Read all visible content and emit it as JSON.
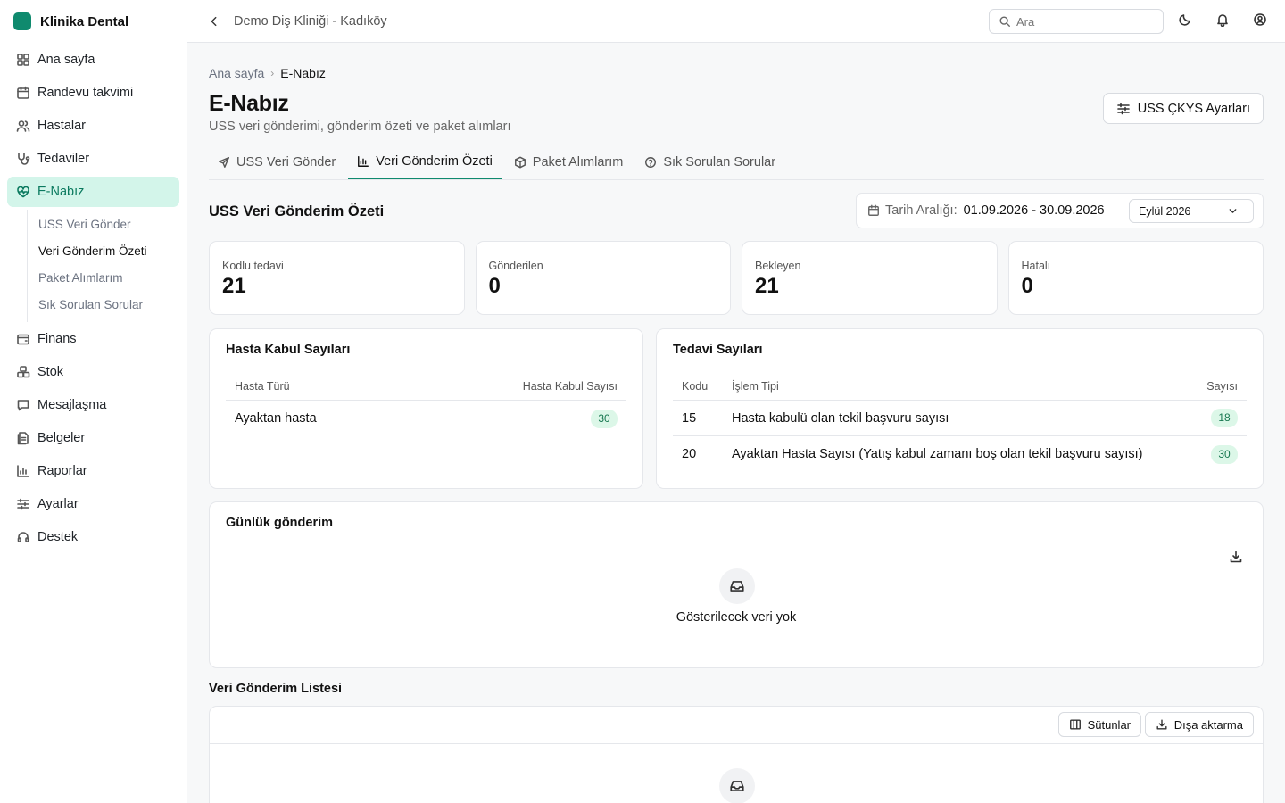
{
  "app": {
    "name": "Klinika Dental",
    "brand_color": "#0f8a6e"
  },
  "sidebar": {
    "items": [
      {
        "label": "Ana sayfa",
        "icon": "grid-icon"
      },
      {
        "label": "Randevu takvimi",
        "icon": "calendar-icon"
      },
      {
        "label": "Hastalar",
        "icon": "users-icon"
      },
      {
        "label": "Tedaviler",
        "icon": "stethoscope-icon"
      },
      {
        "label": "E-Nabız",
        "icon": "heart-pulse-icon",
        "active": true
      },
      {
        "label": "Finans",
        "icon": "wallet-icon"
      },
      {
        "label": "Stok",
        "icon": "boxes-icon"
      },
      {
        "label": "Mesajlaşma",
        "icon": "message-icon"
      },
      {
        "label": "Belgeler",
        "icon": "document-icon"
      },
      {
        "label": "Raporlar",
        "icon": "bar-chart-icon"
      },
      {
        "label": "Ayarlar",
        "icon": "sliders-icon"
      },
      {
        "label": "Destek",
        "icon": "headset-icon"
      }
    ],
    "subitems": [
      {
        "label": "USS Veri Gönder"
      },
      {
        "label": "Veri Gönderim Özeti",
        "active": true
      },
      {
        "label": "Paket Alımlarım"
      },
      {
        "label": "Sık Sorulan Sorular"
      }
    ]
  },
  "topbar": {
    "clinic": "Demo Diş Kliniği - Kadıköy",
    "search_placeholder": "Ara"
  },
  "breadcrumb": {
    "home": "Ana sayfa",
    "current": "E-Nabız"
  },
  "page": {
    "title": "E-Nabız",
    "subtitle": "USS veri gönderimi, gönderim özeti ve paket alımları",
    "settings_button": "USS ÇKYS Ayarları"
  },
  "tabs": [
    {
      "label": "USS Veri Gönder",
      "icon": "send-icon"
    },
    {
      "label": "Veri Gönderim Özeti",
      "icon": "bar-chart-icon",
      "active": true
    },
    {
      "label": "Paket Alımlarım",
      "icon": "package-icon"
    },
    {
      "label": "Sık Sorulan Sorular",
      "icon": "help-circle-icon"
    }
  ],
  "summary": {
    "title": "USS Veri Gönderim Özeti",
    "date_label": "Tarih Aralığı:",
    "date_range": "01.09.2026 - 30.09.2026",
    "month": "Eylül 2026"
  },
  "stats": [
    {
      "label": "Kodlu tedavi",
      "value": "21"
    },
    {
      "label": "Gönderilen",
      "value": "0"
    },
    {
      "label": "Bekleyen",
      "value": "21"
    },
    {
      "label": "Hatalı",
      "value": "0"
    }
  ],
  "patient_admissions": {
    "title": "Hasta Kabul Sayıları",
    "columns": [
      "Hasta Türü",
      "Hasta Kabul Sayısı"
    ],
    "rows": [
      {
        "type": "Ayaktan hasta",
        "count": "30"
      }
    ]
  },
  "treatments": {
    "title": "Tedavi Sayıları",
    "columns": [
      "Kodu",
      "İşlem Tipi",
      "Sayısı"
    ],
    "rows": [
      {
        "code": "15",
        "type": "Hasta kabulü olan tekil başvuru sayısı",
        "count": "18"
      },
      {
        "code": "20",
        "type": "Ayaktan Hasta Sayısı (Yatış kabul zamanı boş olan tekil başvuru sayısı)",
        "count": "30"
      }
    ]
  },
  "daily": {
    "title": "Günlük gönderim",
    "empty": "Gösterilecek veri yok"
  },
  "list": {
    "title": "Veri Gönderim Listesi",
    "columns_button": "Sütunlar",
    "export_button": "Dışa aktarma"
  }
}
